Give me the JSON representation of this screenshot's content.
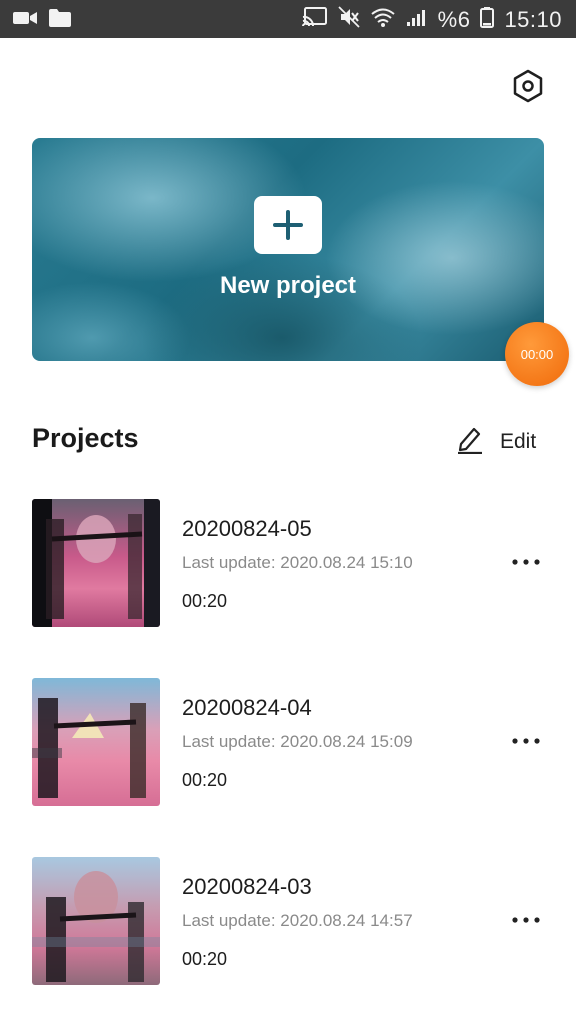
{
  "status_bar": {
    "left_icons": [
      "video-icon",
      "folder-icon"
    ],
    "right_icons": [
      "cast-icon",
      "mute-icon",
      "wifi-icon",
      "signal-icon",
      "battery-icon"
    ],
    "battery_text": "%6",
    "time": "15:10"
  },
  "header": {
    "settings_icon": "hexagon-gear-icon"
  },
  "new_project": {
    "label": "New project"
  },
  "floating_timer": {
    "text": "00:00",
    "color": "#F07A10"
  },
  "projects_section": {
    "title": "Projects",
    "edit_label": "Edit"
  },
  "projects": [
    {
      "name": "20200824-05",
      "last_update": "Last update: 2020.08.24 15:10",
      "duration": "00:20"
    },
    {
      "name": "20200824-04",
      "last_update": "Last update: 2020.08.24 15:09",
      "duration": "00:20"
    },
    {
      "name": "20200824-03",
      "last_update": "Last update: 2020.08.24 14:57",
      "duration": "00:20"
    }
  ]
}
